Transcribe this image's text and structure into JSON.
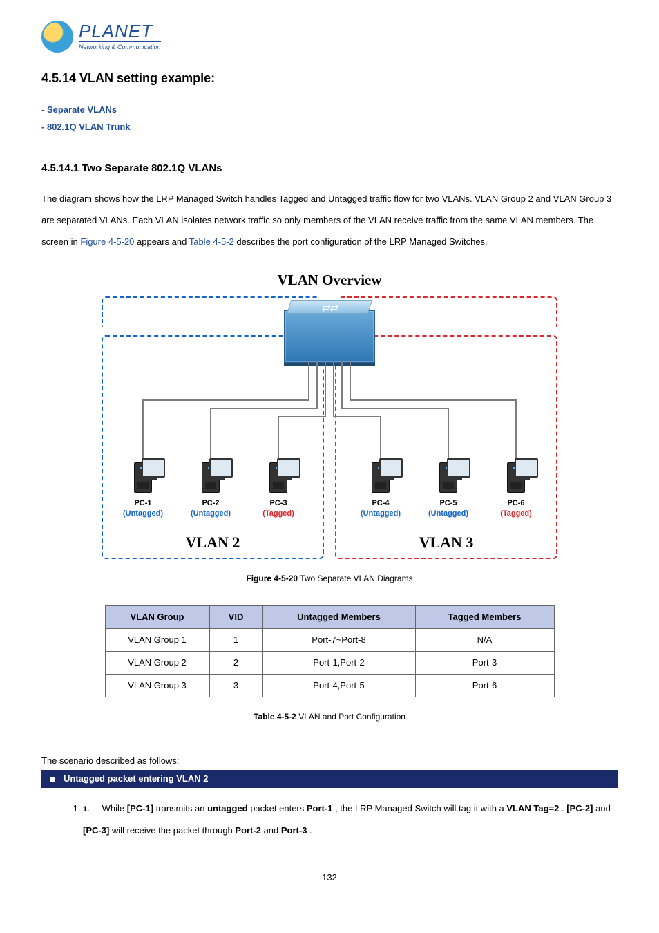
{
  "logo": {
    "brand": "PLANET",
    "tagline": "Networking & Communication"
  },
  "section": {
    "number_title": "4.5.14 VLAN setting example:"
  },
  "bullets": {
    "b1": "- Separate VLANs",
    "b2": "- 802.1Q VLAN Trunk"
  },
  "subsection": {
    "title": "4.5.14.1 Two Separate 802.1Q VLANs"
  },
  "paragraph": {
    "part1": "The diagram shows how the LRP Managed Switch handles Tagged and Untagged traffic flow for two VLANs. VLAN Group 2 and VLAN Group 3 are separated VLANs. Each VLAN isolates network traffic so only members of the VLAN receive traffic from the same VLAN members. The screen in ",
    "fig_link": "Figure 4-5-20",
    "part2": " appears and ",
    "tbl_link": "Table 4-5-2",
    "part3": " describes the port configuration of the LRP Managed Switches."
  },
  "diagram": {
    "title": "VLAN Overview",
    "vlan2_name": "VLAN 2",
    "vlan3_name": "VLAN 3",
    "pcs": [
      {
        "name": "PC-1",
        "tag": "(Untagged)",
        "tagClass": "tag-blue"
      },
      {
        "name": "PC-2",
        "tag": "(Untagged)",
        "tagClass": "tag-blue"
      },
      {
        "name": "PC-3",
        "tag": "(Tagged)",
        "tagClass": "tag-red"
      },
      {
        "name": "PC-4",
        "tag": "(Untagged)",
        "tagClass": "tag-blue"
      },
      {
        "name": "PC-5",
        "tag": "(Untagged)",
        "tagClass": "tag-blue"
      },
      {
        "name": "PC-6",
        "tag": "(Tagged)",
        "tagClass": "tag-red"
      }
    ]
  },
  "figure_caption": {
    "label": "Figure 4-5-20",
    "text": " Two Separate VLAN Diagrams"
  },
  "table": {
    "headers": {
      "c1": "VLAN Group",
      "c2": "VID",
      "c3": "Untagged Members",
      "c4": "Tagged Members"
    },
    "rows": [
      {
        "group": "VLAN Group 1",
        "vid": "1",
        "untagged": "Port-7~Port-8",
        "tagged": "N/A"
      },
      {
        "group": "VLAN Group 2",
        "vid": "2",
        "untagged": "Port-1,Port-2",
        "tagged": "Port-3"
      },
      {
        "group": "VLAN Group 3",
        "vid": "3",
        "untagged": "Port-4,Port-5",
        "tagged": "Port-6"
      }
    ]
  },
  "table_caption": {
    "label": "Table 4-5-2",
    "text": " VLAN and Port Configuration"
  },
  "scenario_intro": "The scenario described as follows:",
  "scenario_bar": "Untagged packet entering VLAN 2",
  "step1": {
    "num": "1.",
    "a": "While ",
    "pc1": "[PC-1]",
    "b": " transmits an ",
    "untagged": "untagged",
    "c": " packet enters ",
    "port1": "Port-1",
    "d": ", the LRP Managed Switch will tag it with a ",
    "vlantag": "VLAN Tag=2",
    "e": ". ",
    "pc2": "[PC-2]",
    "f": " and ",
    "pc3": "[PC-3]",
    "g": " will receive the packet through ",
    "port2": "Port-2",
    "h": " and ",
    "port3": "Port-3",
    "i": "."
  },
  "page_number": "132"
}
